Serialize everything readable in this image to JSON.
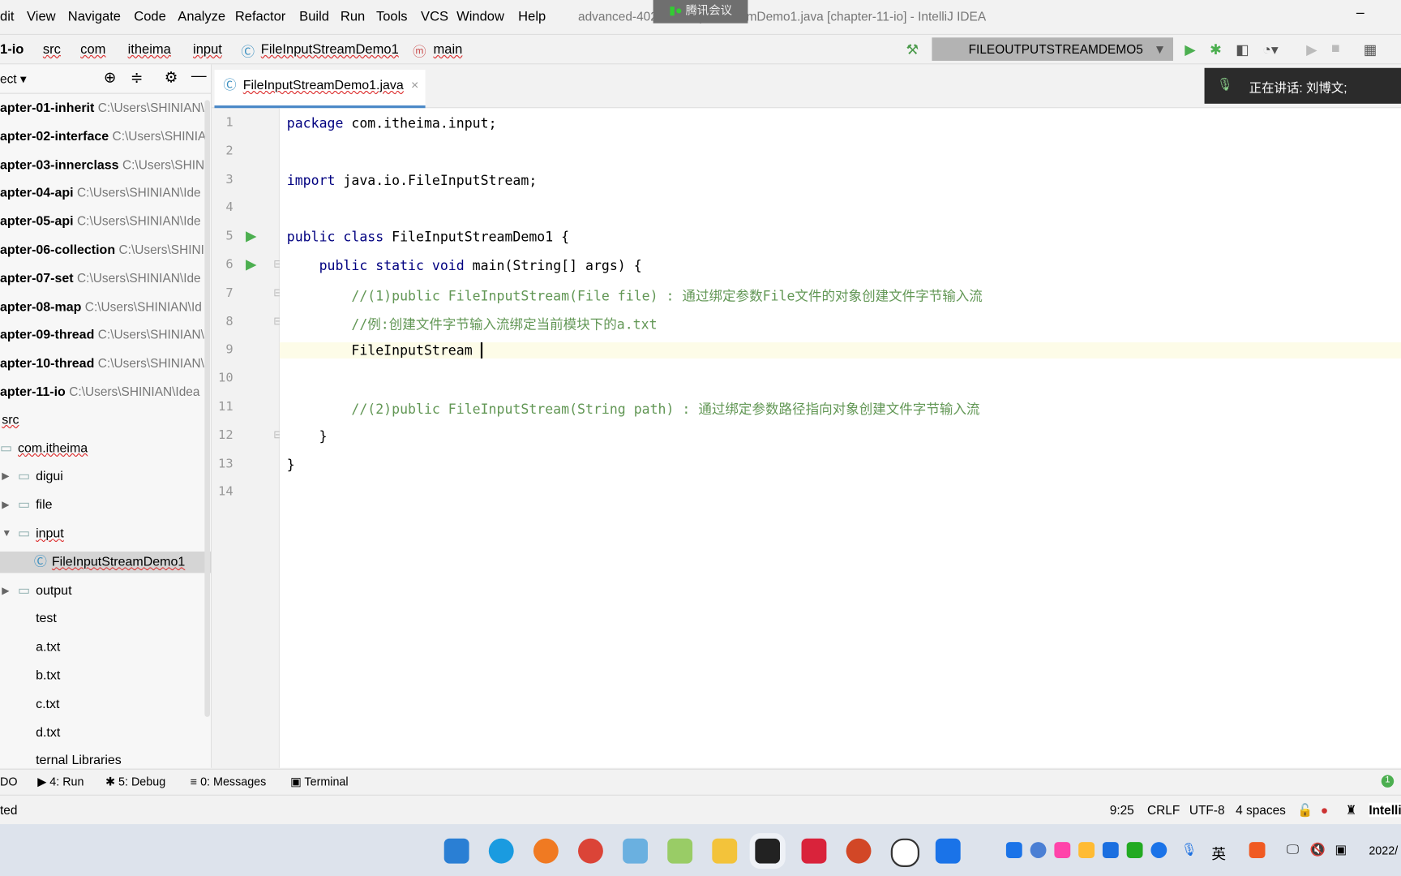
{
  "menu": [
    "dit",
    "View",
    "Navigate",
    "Code",
    "Analyze",
    "Refactor",
    "Build",
    "Run",
    "Tools",
    "VCS",
    "Window",
    "Help"
  ],
  "window_title": "advanced-402 - FileInputStreamDemo1.java [chapter-11-io] - IntelliJ IDEA",
  "meeting_label": "腾讯会议",
  "breadcrumb": [
    "1-io",
    "src",
    "com",
    "itheima",
    "input",
    "FileInputStreamDemo1",
    "main"
  ],
  "run_config": "FILEOUTPUTSTREAMDEMO5",
  "speaking": "正在讲话: 刘博文;",
  "sidebar": {
    "title": "ect",
    "items": [
      {
        "name": "apter-01-inherit",
        "path": "C:\\Users\\SHINIAN\\"
      },
      {
        "name": "apter-02-interface",
        "path": "C:\\Users\\SHINIA"
      },
      {
        "name": "apter-03-innerclass",
        "path": "C:\\Users\\SHINI"
      },
      {
        "name": "apter-04-api",
        "path": "C:\\Users\\SHINIAN\\Ide"
      },
      {
        "name": "apter-05-api",
        "path": "C:\\Users\\SHINIAN\\Ide"
      },
      {
        "name": "apter-06-collection",
        "path": "C:\\Users\\SHINI"
      },
      {
        "name": "apter-07-set",
        "path": "C:\\Users\\SHINIAN\\Ide"
      },
      {
        "name": "apter-08-map",
        "path": "C:\\Users\\SHINIAN\\Id"
      },
      {
        "name": "apter-09-thread",
        "path": "C:\\Users\\SHINIAN\\"
      },
      {
        "name": "apter-10-thread",
        "path": "C:\\Users\\SHINIAN\\"
      },
      {
        "name": "apter-11-io",
        "path": "C:\\Users\\SHINIAN\\Idea"
      }
    ],
    "tree": [
      "src",
      "com.itheima",
      "digui",
      "file",
      "input",
      "FileInputStreamDemo1",
      "output",
      "test",
      "a.txt",
      "b.txt",
      "c.txt",
      "d.txt",
      "ternal Libraries"
    ]
  },
  "editor": {
    "tab": "FileInputStreamDemo1.java",
    "lines": [
      "package com.itheima.input;",
      "",
      "import java.io.FileInputStream;",
      "",
      "public class FileInputStreamDemo1 {",
      "    public static void main(String[] args) {",
      "        //(1)public FileInputStream(File file) : 通过绑定参数File文件的对象创建文件字节输入流",
      "        //例:创建文件字节输入流绑定当前模块下的a.txt",
      "        FileInputStream ",
      "",
      "        //(2)public FileInputStream(String path) : 通过绑定参数路径指向对象创建文件字节输入流",
      "    }",
      "}",
      ""
    ]
  },
  "toolwindows": [
    {
      "k": "",
      "label": "DO"
    },
    {
      "k": "4",
      "label": "4: Run"
    },
    {
      "k": "5",
      "label": "5: Debug"
    },
    {
      "k": "0",
      "label": "0: Messages"
    },
    {
      "k": "",
      "label": "Terminal"
    }
  ],
  "status": {
    "left": "ted",
    "pos": "9:25",
    "sep": "CRLF",
    "enc": "UTF-8",
    "indent": "4 spaces",
    "brand": "Intelli"
  },
  "tray": {
    "ime": "英",
    "date": "2022/"
  },
  "colors": {
    "accent": "#4a88c7",
    "comment": "#629755",
    "keyword": "#000080",
    "run": "#4caf50"
  }
}
